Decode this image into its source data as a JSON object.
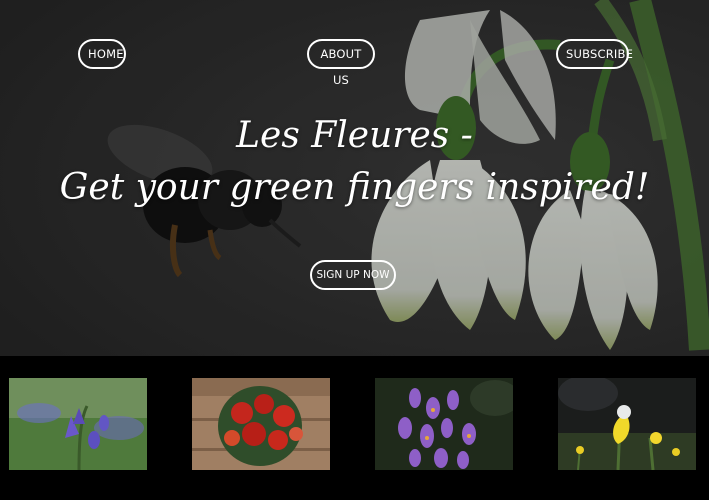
{
  "nav": {
    "home": "HOME",
    "about": "ABOUT US",
    "subscribe": "SUBSCRIBE"
  },
  "hero": {
    "title_line1": "Les Fleures -",
    "title_line2": "Get your green fingers inspired!",
    "cta_label": "SIGN UP NOW"
  },
  "gallery": {
    "images": [
      {
        "subject": "bluebell flowers"
      },
      {
        "subject": "red rose bouquet"
      },
      {
        "subject": "purple crocuses"
      },
      {
        "subject": "yellow daffodils"
      }
    ]
  },
  "colors": {
    "hero_bg": "#2e2e2e",
    "text": "#ffffff",
    "gallery_bg": "#000000"
  }
}
